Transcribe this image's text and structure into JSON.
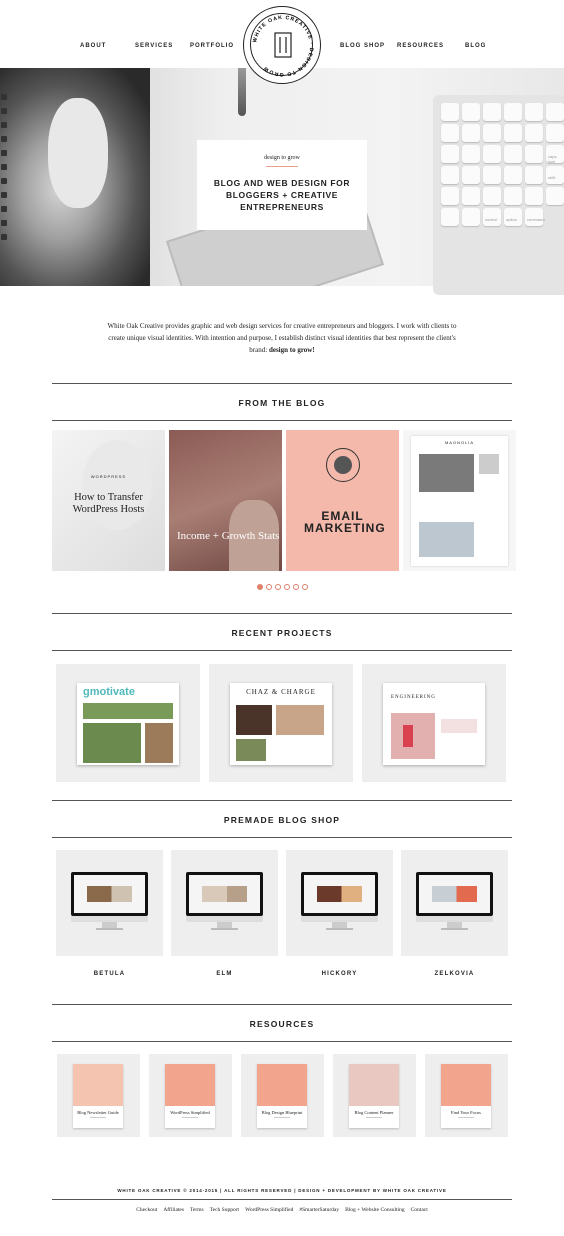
{
  "nav": {
    "left": [
      "ABOUT",
      "SERVICES",
      "PORTFOLIO"
    ],
    "right": [
      "BLOG SHOP",
      "RESOURCES",
      "BLOG"
    ]
  },
  "logo": {
    "text": "WHITE OAK CREATIVE · DESIGN TO GROW"
  },
  "hero": {
    "tagline": "design to grow",
    "headline": "BLOG AND WEB DESIGN FOR BLOGGERS + CREATIVE ENTREPRENEURS",
    "keyboard_keys": [
      "",
      "",
      "",
      "",
      "",
      "",
      "",
      "",
      "",
      "",
      "",
      "",
      "",
      "",
      "",
      "",
      "",
      "caps lock",
      "",
      "",
      "",
      "",
      "",
      "shift",
      "",
      "",
      "",
      "",
      "",
      "",
      "",
      "",
      "control",
      "option",
      "command"
    ]
  },
  "social_icons": [
    "behance-icon",
    "heart-icon",
    "pinterest-icon",
    "facebook-icon",
    "google-plus-icon",
    "instagram-icon",
    "linkedin-icon",
    "pinterest-icon",
    "tumblr-icon",
    "twitter-icon",
    "email-icon"
  ],
  "intro": {
    "text": "White Oak Creative provides graphic and web design services for creative entrepreneurs and bloggers. I work with clients to create unique visual identities. With intention and purpose, I establish distinct visual identities that best represent the client's brand: ",
    "emphasis": "design to grow!"
  },
  "sections": {
    "blog": "FROM THE BLOG",
    "projects": "RECENT PROJECTS",
    "shop": "PREMADE BLOG SHOP",
    "resources": "RESOURCES"
  },
  "blog_posts": [
    {
      "kicker": "WORDPRESS",
      "title": "How to Transfer WordPress Hosts"
    },
    {
      "kicker": "",
      "title": "Income + Growth Stats"
    },
    {
      "kicker": "",
      "title": "EMAIL MARKETING"
    },
    {
      "kicker": "MAGNOLIA",
      "title": ""
    }
  ],
  "carousel": {
    "pages": 6,
    "active": 1
  },
  "projects": [
    {
      "name": "gmotivate"
    },
    {
      "name": "CHAZ & CHARGE"
    },
    {
      "name": "ENGINEERING"
    }
  ],
  "themes": [
    "BETULA",
    "ELM",
    "HICKORY",
    "ZELKOVIA"
  ],
  "resources": [
    "Blog Newsletter Guide",
    "WordPress Simplified",
    "Blog Design Blueprint",
    "Blog Content Planner",
    "Find Your Focus"
  ],
  "footer": {
    "copyright": "WHITE OAK CREATIVE © 2014-2015 | ALL RIGHTS RESERVED | DESIGN + DEVELOPMENT BY WHITE OAK CREATIVE",
    "links": [
      "Checkout",
      "Affiliates",
      "Terms",
      "Tech Support",
      "WordPress Simplified",
      "#SmarterSaturday",
      "Blog + Website Consulting",
      "Contact"
    ]
  },
  "colors": {
    "accent": "#e08068",
    "pink": "#f4b9aa",
    "panel": "#eeeeee"
  }
}
